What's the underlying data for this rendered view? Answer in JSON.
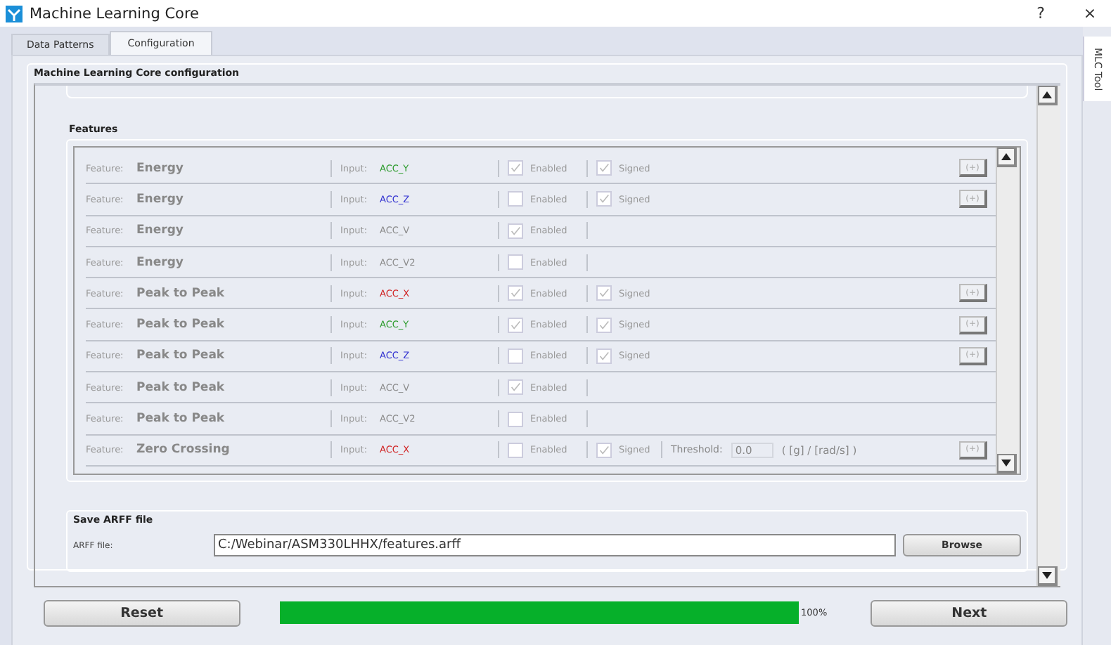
{
  "window": {
    "title": "Machine Learning Core",
    "buttons": [
      "?",
      "×"
    ]
  },
  "tabs": [
    {
      "label": "Data Patterns",
      "selected": false
    },
    {
      "label": "Configuration",
      "selected": true
    }
  ],
  "side_tab": {
    "label": "MLC Tool"
  },
  "group": {
    "title": "Machine Learning Core configuration"
  },
  "features": {
    "title": "Features",
    "rows": [
      {
        "kind": "axis",
        "feature_label": "Feature:",
        "feature": "Energy",
        "input_label": "Input:",
        "input": "ACC_Y",
        "color": "#2a9a2a",
        "enabled": true,
        "enabled_label": "Enabled",
        "signed": true,
        "signed_label": "Signed",
        "button": "(+)"
      },
      {
        "kind": "axis",
        "feature_label": "Feature:",
        "feature": "Energy",
        "input_label": "Input:",
        "input": "ACC_Z",
        "color": "#3030d0",
        "enabled": false,
        "enabled_label": "Enabled",
        "signed": true,
        "signed_label": "Signed",
        "button": "(+)"
      },
      {
        "kind": "norm",
        "feature_label": "Feature:",
        "feature": "Energy",
        "input_label": "Input:",
        "input": "ACC_V",
        "color": "#8a8a8a",
        "enabled": true,
        "enabled_label": "Enabled"
      },
      {
        "kind": "norm",
        "feature_label": "Feature:",
        "feature": "Energy",
        "input_label": "Input:",
        "input": "ACC_V2",
        "color": "#8a8a8a",
        "enabled": false,
        "enabled_label": "Enabled"
      },
      {
        "kind": "axis",
        "feature_label": "Feature:",
        "feature": "Peak to Peak",
        "input_label": "Input:",
        "input": "ACC_X",
        "color": "#d02020",
        "enabled": true,
        "enabled_label": "Enabled",
        "signed": true,
        "signed_label": "Signed",
        "button": "(+)"
      },
      {
        "kind": "axis",
        "feature_label": "Feature:",
        "feature": "Peak to Peak",
        "input_label": "Input:",
        "input": "ACC_Y",
        "color": "#2a9a2a",
        "enabled": true,
        "enabled_label": "Enabled",
        "signed": true,
        "signed_label": "Signed",
        "button": "(+)"
      },
      {
        "kind": "axis",
        "feature_label": "Feature:",
        "feature": "Peak to Peak",
        "input_label": "Input:",
        "input": "ACC_Z",
        "color": "#3030d0",
        "enabled": false,
        "enabled_label": "Enabled",
        "signed": true,
        "signed_label": "Signed",
        "button": "(+)"
      },
      {
        "kind": "norm",
        "feature_label": "Feature:",
        "feature": "Peak to Peak",
        "input_label": "Input:",
        "input": "ACC_V",
        "color": "#8a8a8a",
        "enabled": true,
        "enabled_label": "Enabled"
      },
      {
        "kind": "norm",
        "feature_label": "Feature:",
        "feature": "Peak to Peak",
        "input_label": "Input:",
        "input": "ACC_V2",
        "color": "#8a8a8a",
        "enabled": false,
        "enabled_label": "Enabled"
      },
      {
        "kind": "threshold",
        "feature_label": "Feature:",
        "feature": "Zero Crossing",
        "input_label": "Input:",
        "input": "ACC_X",
        "color": "#d02020",
        "enabled": false,
        "enabled_label": "Enabled",
        "signed": true,
        "signed_label": "Signed",
        "threshold_label": "Threshold:",
        "threshold": "0.0",
        "unit": "( [g] / [rad/s] )",
        "button": "(+)"
      }
    ]
  },
  "save": {
    "title": "Save ARFF file",
    "label": "ARFF file:",
    "value": "C:/Webinar/ASM330LHHX/features.arff",
    "button": "Browse"
  },
  "footer": {
    "reset": "Reset",
    "progress": {
      "level": 1.0,
      "reading": "100%"
    },
    "next": "Next"
  }
}
